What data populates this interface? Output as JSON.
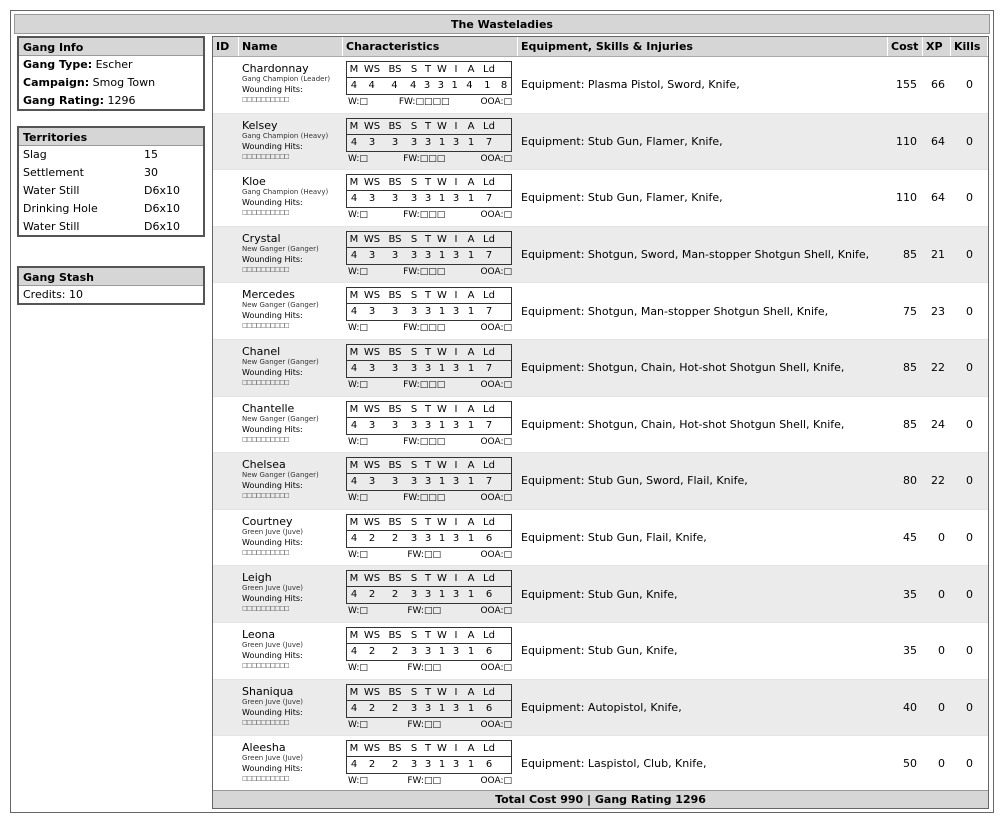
{
  "title": "The Wasteladies",
  "gang_info": {
    "title": "Gang Info",
    "type_label": "Gang Type:",
    "type_value": "Escher",
    "campaign_label": "Campaign:",
    "campaign_value": "Smog Town",
    "rating_label": "Gang Rating:",
    "rating_value": "1296"
  },
  "territories": {
    "title": "Territories",
    "items": [
      {
        "name": "Slag",
        "value": "15"
      },
      {
        "name": "Settlement",
        "value": "30"
      },
      {
        "name": "Water Still",
        "value": "D6x10"
      },
      {
        "name": "Drinking Hole",
        "value": "D6x10"
      },
      {
        "name": "Water Still",
        "value": "D6x10"
      }
    ]
  },
  "stash": {
    "title": "Gang Stash",
    "credits_label": "Credits:",
    "credits_value": "10"
  },
  "columns": {
    "id": "ID",
    "name": "Name",
    "characteristics": "Characteristics",
    "equipment": "Equipment, Skills & Injuries",
    "cost": "Cost",
    "xp": "XP",
    "kills": "Kills"
  },
  "stat_headers": [
    "M",
    "WS",
    "BS",
    "S",
    "T",
    "W",
    "I",
    "A",
    "Ld"
  ],
  "wounding_label": "Wounding Hits:",
  "wounding_boxes": "□□□□□□□□□□",
  "status_labels": {
    "w": "W:□",
    "fw_prefix": "FW:",
    "ooa": "OOA:□"
  },
  "gangers": [
    {
      "name": "Chardonnay",
      "type": "Gang Champion (Leader)",
      "stats": [
        "4",
        "4",
        "4",
        "4",
        "3",
        "3",
        "1",
        "4",
        "1",
        "8"
      ],
      "fw": "□□□□",
      "equipment": "Equipment: Plasma Pistol, Sword, Knife,",
      "cost": "155",
      "xp": "66",
      "kills": "0"
    },
    {
      "name": "Kelsey",
      "type": "Gang Champion (Heavy)",
      "stats": [
        "4",
        "3",
        "3",
        "3",
        "3",
        "1",
        "3",
        "1",
        "7"
      ],
      "fw": "□□□",
      "equipment": "Equipment: Stub Gun, Flamer, Knife,",
      "cost": "110",
      "xp": "64",
      "kills": "0"
    },
    {
      "name": "Kloe",
      "type": "Gang Champion (Heavy)",
      "stats": [
        "4",
        "3",
        "3",
        "3",
        "3",
        "1",
        "3",
        "1",
        "7"
      ],
      "fw": "□□□",
      "equipment": "Equipment: Stub Gun, Flamer, Knife,",
      "cost": "110",
      "xp": "64",
      "kills": "0"
    },
    {
      "name": "Crystal",
      "type": "New Ganger (Ganger)",
      "stats": [
        "4",
        "3",
        "3",
        "3",
        "3",
        "1",
        "3",
        "1",
        "7"
      ],
      "fw": "□□□",
      "equipment": "Equipment: Shotgun, Sword, Man-stopper Shotgun Shell, Knife,",
      "cost": "85",
      "xp": "21",
      "kills": "0"
    },
    {
      "name": "Mercedes",
      "type": "New Ganger (Ganger)",
      "stats": [
        "4",
        "3",
        "3",
        "3",
        "3",
        "1",
        "3",
        "1",
        "7"
      ],
      "fw": "□□□",
      "equipment": "Equipment: Shotgun, Man-stopper Shotgun Shell, Knife,",
      "cost": "75",
      "xp": "23",
      "kills": "0"
    },
    {
      "name": "Chanel",
      "type": "New Ganger (Ganger)",
      "stats": [
        "4",
        "3",
        "3",
        "3",
        "3",
        "1",
        "3",
        "1",
        "7"
      ],
      "fw": "□□□",
      "equipment": "Equipment: Shotgun, Chain, Hot-shot Shotgun Shell, Knife,",
      "cost": "85",
      "xp": "22",
      "kills": "0"
    },
    {
      "name": "Chantelle",
      "type": "New Ganger (Ganger)",
      "stats": [
        "4",
        "3",
        "3",
        "3",
        "3",
        "1",
        "3",
        "1",
        "7"
      ],
      "fw": "□□□",
      "equipment": "Equipment: Shotgun, Chain, Hot-shot Shotgun Shell, Knife,",
      "cost": "85",
      "xp": "24",
      "kills": "0"
    },
    {
      "name": "Chelsea",
      "type": "New Ganger (Ganger)",
      "stats": [
        "4",
        "3",
        "3",
        "3",
        "3",
        "1",
        "3",
        "1",
        "7"
      ],
      "fw": "□□□",
      "equipment": "Equipment: Stub Gun, Sword, Flail, Knife,",
      "cost": "80",
      "xp": "22",
      "kills": "0"
    },
    {
      "name": "Courtney",
      "type": "Green Juve (Juve)",
      "stats": [
        "4",
        "2",
        "2",
        "3",
        "3",
        "1",
        "3",
        "1",
        "6"
      ],
      "fw": "□□",
      "equipment": "Equipment: Stub Gun, Flail, Knife,",
      "cost": "45",
      "xp": "0",
      "kills": "0"
    },
    {
      "name": "Leigh",
      "type": "Green Juve (Juve)",
      "stats": [
        "4",
        "2",
        "2",
        "3",
        "3",
        "1",
        "3",
        "1",
        "6"
      ],
      "fw": "□□",
      "equipment": "Equipment: Stub Gun, Knife,",
      "cost": "35",
      "xp": "0",
      "kills": "0"
    },
    {
      "name": "Leona",
      "type": "Green Juve (Juve)",
      "stats": [
        "4",
        "2",
        "2",
        "3",
        "3",
        "1",
        "3",
        "1",
        "6"
      ],
      "fw": "□□",
      "equipment": "Equipment: Stub Gun, Knife,",
      "cost": "35",
      "xp": "0",
      "kills": "0"
    },
    {
      "name": "Shaniqua",
      "type": "Green Juve (Juve)",
      "stats": [
        "4",
        "2",
        "2",
        "3",
        "3",
        "1",
        "3",
        "1",
        "6"
      ],
      "fw": "□□",
      "equipment": "Equipment: Autopistol, Knife,",
      "cost": "40",
      "xp": "0",
      "kills": "0"
    },
    {
      "name": "Aleesha",
      "type": "Green Juve (Juve)",
      "stats": [
        "4",
        "2",
        "2",
        "3",
        "3",
        "1",
        "3",
        "1",
        "6"
      ],
      "fw": "□□",
      "equipment": "Equipment: Laspistol, Club, Knife,",
      "cost": "50",
      "xp": "0",
      "kills": "0"
    }
  ],
  "footer": "Total Cost 990   |   Gang Rating 1296"
}
